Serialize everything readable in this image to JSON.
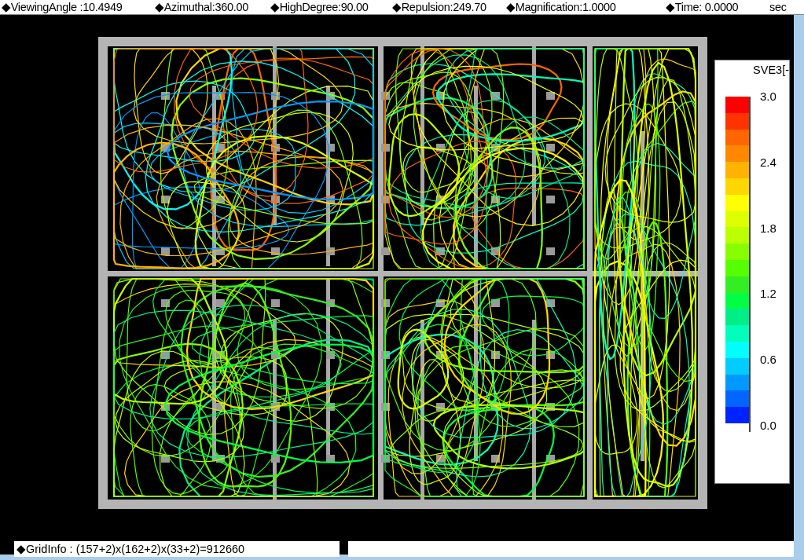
{
  "header": {
    "items": [
      {
        "label": "◆ViewingAngle :10.4949"
      },
      {
        "label": "◆Azimuthal:360.00"
      },
      {
        "label": "◆HighDegree:90.00"
      },
      {
        "label": "◆Repulsion:249.70"
      },
      {
        "label": "◆Magnification:1.0000"
      },
      {
        "label": "◆Time: 0.0000"
      }
    ],
    "unit": "sec"
  },
  "legend": {
    "title": "SVE3[-",
    "segments": [
      {
        "color": "#ff0000"
      },
      {
        "color": "#ff3300"
      },
      {
        "color": "#ff6600"
      },
      {
        "color": "#ff8800"
      },
      {
        "color": "#ffb300"
      },
      {
        "color": "#ffd700"
      },
      {
        "color": "#ffff00"
      },
      {
        "color": "#ddff00"
      },
      {
        "color": "#bbff00"
      },
      {
        "color": "#88ff00"
      },
      {
        "color": "#55ff00"
      },
      {
        "color": "#33ee22"
      },
      {
        "color": "#00ff44"
      },
      {
        "color": "#00ee88"
      },
      {
        "color": "#00ffbb"
      },
      {
        "color": "#00ffff"
      },
      {
        "color": "#00ccff"
      },
      {
        "color": "#0099ff"
      },
      {
        "color": "#0066ff"
      },
      {
        "color": "#0022ff"
      }
    ],
    "labels": [
      "3.0",
      "2.4",
      "1.8",
      "1.2",
      "0.6",
      "0.0"
    ]
  },
  "status_bar": {
    "grid_info": "◆GridInfo : (157+2)x(162+2)x(33+2)=912660"
  }
}
